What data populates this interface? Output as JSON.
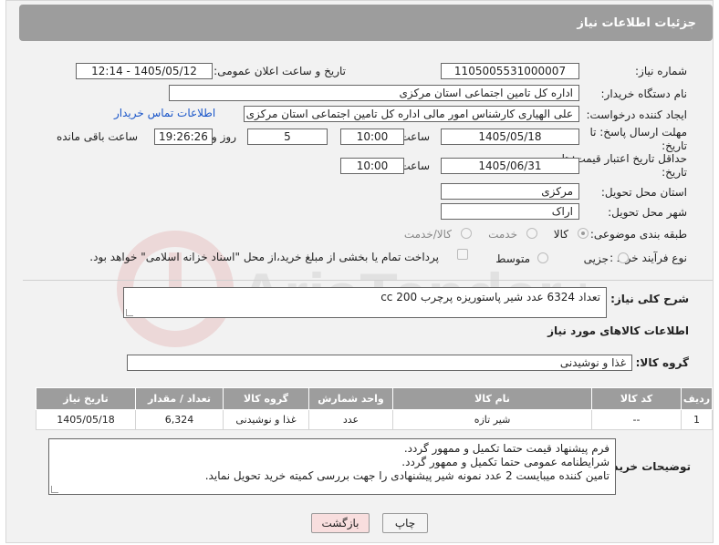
{
  "header": {
    "title": "جزئیات اطلاعات نیاز"
  },
  "fields": {
    "need_number_label": "شماره نیاز:",
    "need_number": "1105005531000007",
    "announce_label": "تاریخ و ساعت اعلان عمومی:",
    "announce_value": "1405/05/12 - 12:14",
    "buyer_org_label": "نام دستگاه خریدار:",
    "buyer_org": "اداره کل تامین اجتماعی استان مرکزی",
    "creator_label": "ایجاد کننده درخواست:",
    "creator": "علی الهیاری کارشناس امور مالی اداره کل تامین اجتماعی استان مرکزی",
    "contact_link": "اطلاعات تماس خریدار",
    "reply_deadline_label": "مهلت ارسال پاسخ: تا تاریخ:",
    "reply_date": "1405/05/18",
    "time_label": "ساعت",
    "reply_time": "10:00",
    "days": "5",
    "days_label": "روز و",
    "remaining_time": "19:26:26",
    "remaining_label": "ساعت باقی مانده",
    "price_validity_label": "حداقل تاریخ اعتبار قیمت: تا تاریخ:",
    "price_date": "1405/06/31",
    "price_time": "10:00",
    "province_label": "استان محل تحویل:",
    "province": "مرکزی",
    "city_label": "شهر محل تحویل:",
    "city": "اراک",
    "category_label": "طبقه بندی موضوعی:",
    "category_options": [
      "کالا",
      "خدمت",
      "کالا/خدمت"
    ],
    "process_label": "نوع فرآیند خرید :",
    "process_options": [
      "جزیی",
      "متوسط"
    ],
    "payment_note": "پرداخت تمام یا بخشی از مبلغ خرید،از محل \"اسناد خزانه اسلامی\" خواهد بود."
  },
  "description": {
    "label": "شرح کلی نیاز:",
    "text": "تعداد 6324 عدد شیر پاستوریزه پرچرب 200 cc"
  },
  "goods": {
    "section_title": "اطلاعات کالاهای مورد نیاز",
    "group_label": "گروه کالا:",
    "group_value": "غذا و نوشیدنی",
    "columns": [
      "ردیف",
      "کد کالا",
      "نام کالا",
      "واحد شمارش",
      "گروه کالا",
      "تعداد / مقدار",
      "تاریخ نیاز"
    ],
    "rows": [
      [
        "1",
        "--",
        "شیر تازه",
        "عدد",
        "غذا و نوشیدنی",
        "6,324",
        "1405/05/18"
      ]
    ]
  },
  "buyer_notes": {
    "label": "توضیحات خریدار:",
    "lines": [
      "فرم پیشنهاد قیمت حتما تکمیل و ممهور گردد.",
      "شرایطنامه عمومی حتما تکمیل و ممهور گردد.",
      "تامین کننده میبایست 2 عدد نمونه شیر پیشنهادی را جهت بررسی کمیته خرید تحویل نماید."
    ]
  },
  "buttons": {
    "print": "چاپ",
    "back": "بازگشت"
  },
  "watermark_text": "AriaTender.net",
  "colors": {
    "header": "#9d9d9d",
    "link": "#1a56c9",
    "back_button": "#f8dede"
  }
}
